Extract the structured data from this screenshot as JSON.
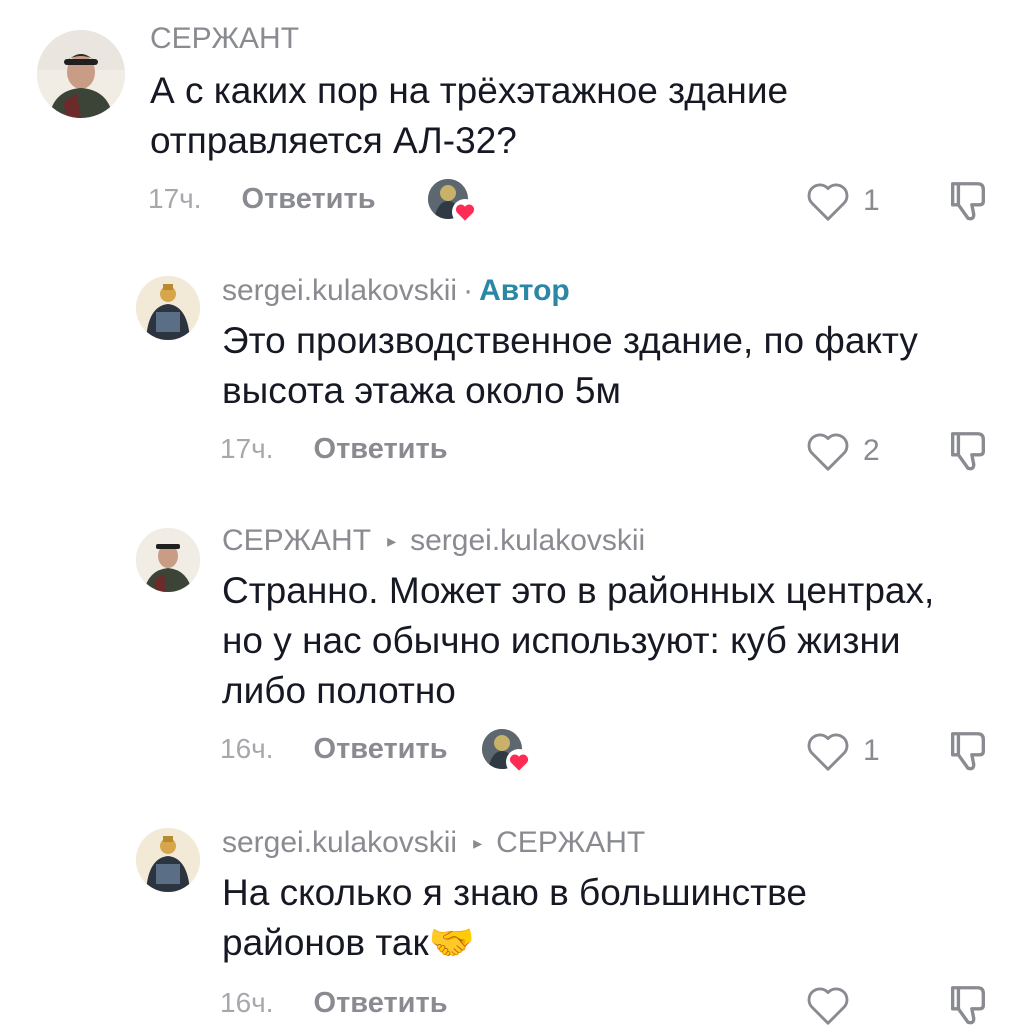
{
  "comments": [
    {
      "author": "СЕРЖАНТ",
      "text_lines": [
        "А с каких пор на трёхэтажное здание",
        "отправляется АЛ-32?"
      ],
      "time": "17ч.",
      "reply_label": "Ответить",
      "likes": "1"
    },
    {
      "author": "sergei.kulakovskii",
      "separator": "·",
      "badge": "Автор",
      "text_lines": [
        "Это производственное здание, по факту",
        "высота этажа около 5м"
      ],
      "time": "17ч.",
      "reply_label": "Ответить",
      "likes": "2"
    },
    {
      "author": "СЕРЖАНТ",
      "reply_to": "sergei.kulakovskii",
      "text_lines": [
        "Странно. Может это в районных центрах,",
        "но у нас обычно используют: куб жизни",
        "либо полотно"
      ],
      "time": "16ч.",
      "reply_label": "Ответить",
      "likes": "1"
    },
    {
      "author": "sergei.kulakovskii",
      "reply_to": "СЕРЖАНТ",
      "text_lines": [
        "На сколько я знаю в большинстве",
        "районов так🤝"
      ],
      "time": "16ч.",
      "reply_label": "Ответить",
      "likes": ""
    }
  ],
  "icons": {
    "like": "heart-outline-icon",
    "dislike": "thumbs-down-outline-icon",
    "creator_liked": "creator-liked-heart-icon",
    "reply_arrow": "▸"
  },
  "colors": {
    "text": "#161823",
    "muted": "#8a8b91",
    "author_badge": "#2a87a6",
    "heart_badge": "#fe2c55"
  }
}
